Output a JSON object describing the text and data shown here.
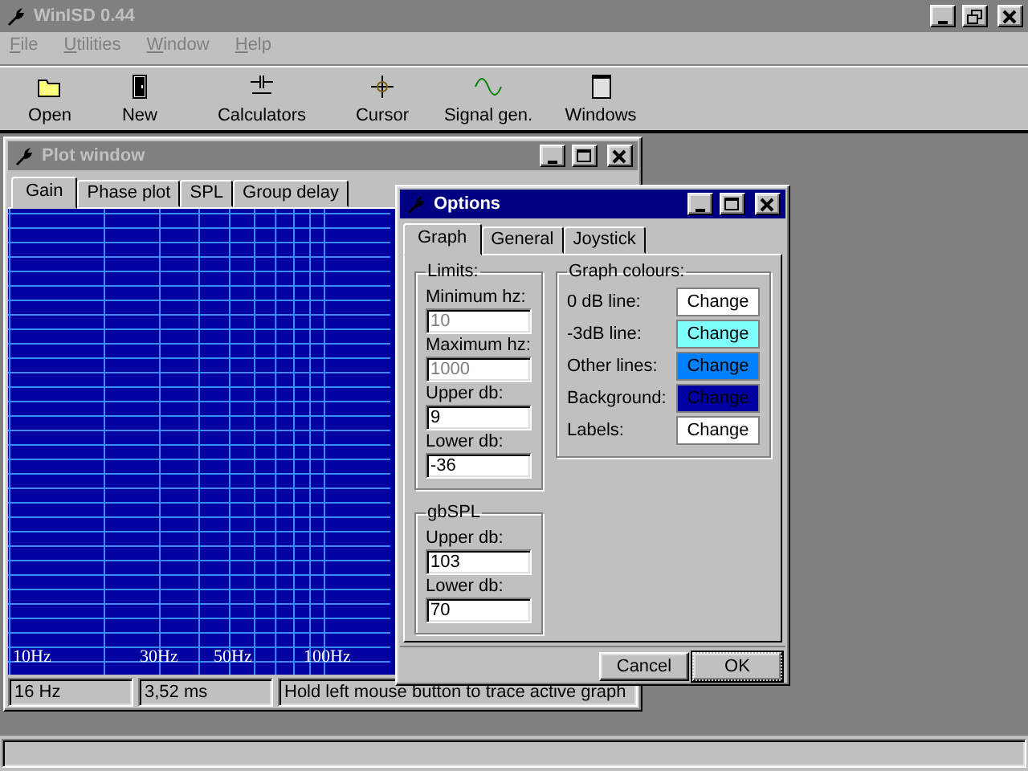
{
  "window": {
    "title": "WinISD 0.44",
    "active": false
  },
  "menu": [
    {
      "label": "File"
    },
    {
      "label": "Utilities"
    },
    {
      "label": "Window"
    },
    {
      "label": "Help"
    }
  ],
  "toolbar": [
    {
      "label": "Open",
      "kind": "folder"
    },
    {
      "label": "New",
      "kind": "door"
    },
    {
      "label": "Calculators",
      "kind": "circuit"
    },
    {
      "label": "Cursor",
      "kind": "crosshair"
    },
    {
      "label": "Signal gen.",
      "kind": "wave"
    },
    {
      "label": "Windows",
      "kind": "window"
    }
  ],
  "plot_window": {
    "title": "Plot window",
    "active": false,
    "tabs": [
      {
        "label": "Gain",
        "selected": true
      },
      {
        "label": "Phase plot",
        "selected": false
      },
      {
        "label": "SPL",
        "selected": false
      },
      {
        "label": "Group delay",
        "selected": false
      }
    ],
    "axis_labels": [
      "10Hz",
      "30Hz",
      "50Hz",
      "100Hz"
    ],
    "status": [
      "16 Hz",
      "3,52 ms",
      "Hold left mouse button to trace active graph"
    ]
  },
  "options_dialog": {
    "title": "Options",
    "active": true,
    "tabs": [
      {
        "label": "Graph",
        "selected": true
      },
      {
        "label": "General",
        "selected": false
      },
      {
        "label": "Joystick",
        "selected": false
      }
    ],
    "limits": {
      "title": "Limits:",
      "fields": [
        {
          "label": "Minimum hz:",
          "value": "10",
          "disabled": true
        },
        {
          "label": "Maximum hz:",
          "value": "1000",
          "disabled": true
        },
        {
          "label": "Upper db:",
          "value": "9",
          "disabled": false
        },
        {
          "label": "Lower db:",
          "value": "-36",
          "disabled": false
        }
      ]
    },
    "gbspl": {
      "title": "gbSPL",
      "fields": [
        {
          "label": "Upper db:",
          "value": "103",
          "disabled": false
        },
        {
          "label": "Lower db:",
          "value": "70",
          "disabled": false
        }
      ]
    },
    "graph_colours": {
      "title": "Graph colours:",
      "items": [
        {
          "label": "0 dB line:",
          "button": "Change",
          "color": "#ffffff"
        },
        {
          "label": "-3dB line:",
          "button": "Change",
          "color": "#80ffff"
        },
        {
          "label": "Other lines:",
          "button": "Change",
          "color": "#0080ff"
        },
        {
          "label": "Background:",
          "button": "Change",
          "color": "#0000a0"
        },
        {
          "label": "Labels:",
          "button": "Change",
          "color": "#ffffff"
        }
      ]
    },
    "buttons": [
      {
        "label": "Cancel",
        "default": false
      },
      {
        "label": "OK",
        "default": true
      }
    ]
  }
}
